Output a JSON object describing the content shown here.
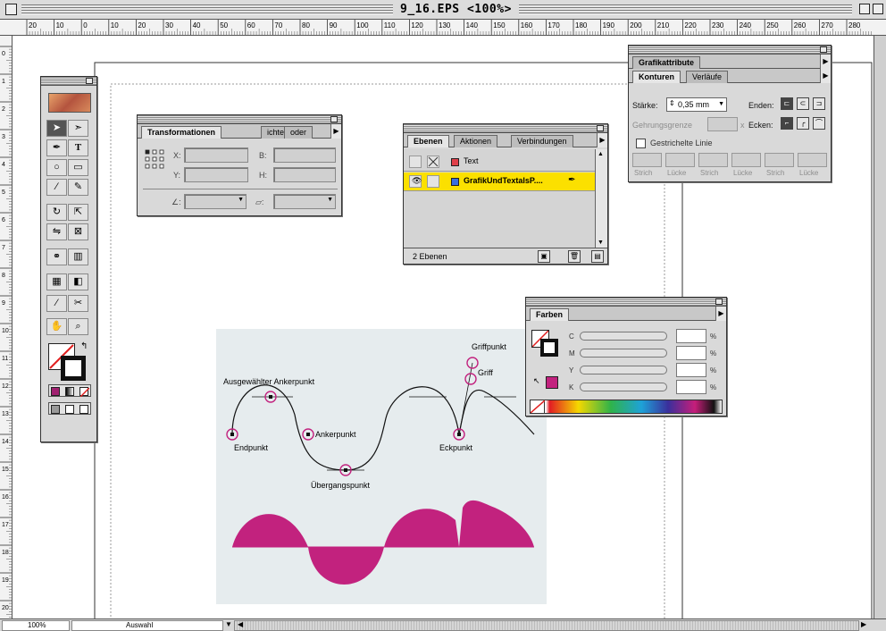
{
  "window": {
    "title": "9_16.EPS <100%>"
  },
  "rulers": {
    "top_ticks": [
      "20",
      "10",
      "0",
      "10",
      "20",
      "30",
      "40",
      "50",
      "60",
      "70",
      "80",
      "90",
      "100",
      "110",
      "120",
      "130",
      "140",
      "150",
      "160",
      "170",
      "180",
      "190",
      "200",
      "210",
      "220",
      "230",
      "240",
      "250",
      "260",
      "270",
      "280"
    ],
    "left_ticks": [
      "0",
      "1",
      "2",
      "3",
      "4",
      "5",
      "6",
      "7",
      "8",
      "9",
      "10",
      "11",
      "12",
      "13",
      "14",
      "15",
      "16",
      "17",
      "18",
      "19",
      "20"
    ]
  },
  "statusbar": {
    "zoom": "100%",
    "status": "Auswahl"
  },
  "transform_palette": {
    "tabs": [
      "Transformationen",
      "ichten",
      "oder"
    ],
    "labels": {
      "x": "X:",
      "y": "Y:",
      "b": "B:",
      "h": "H:"
    }
  },
  "layers_palette": {
    "tabs": [
      "Ebenen",
      "Aktionen",
      "Verbindungen"
    ],
    "layers": [
      {
        "name": "Text",
        "color": "#e0404a"
      },
      {
        "name": "GrafikUndTextalsP....",
        "color": "#3a6fe0"
      }
    ],
    "footer": "2 Ebenen",
    "highlight_color": "#fbe000"
  },
  "stroke_palette": {
    "tabs_top": [
      "Grafikattribute"
    ],
    "tabs": [
      "Konturen",
      "Verläufe"
    ],
    "weight_label": "Stärke:",
    "weight_value": "0,35 mm",
    "ends_label": "Enden:",
    "miter_label": "Gehrungsgrenze",
    "miter_unit": "x",
    "corners_label": "Ecken:",
    "dashed_label": "Gestrichelte Linie",
    "dash_labels": [
      "Strich",
      "Lücke",
      "Strich",
      "Lücke",
      "Strich",
      "Lücke"
    ]
  },
  "color_palette": {
    "tab": "Farben",
    "channels": [
      {
        "label": "C",
        "unit": "%"
      },
      {
        "label": "M",
        "unit": "%"
      },
      {
        "label": "Y",
        "unit": "%"
      },
      {
        "label": "K",
        "unit": "%"
      }
    ],
    "fill_color": "#c2227e"
  },
  "illustration": {
    "background": "#e6ecee",
    "accent": "#c2227e",
    "labels": {
      "selected_anchor": "Ausgewählter Ankerpunkt",
      "endpoint": "Endpunkt",
      "anchor": "Ankerpunkt",
      "transition": "Übergangspunkt",
      "corner": "Eckpunkt",
      "handle_point": "Griffpunkt",
      "handle": "Griff"
    }
  }
}
